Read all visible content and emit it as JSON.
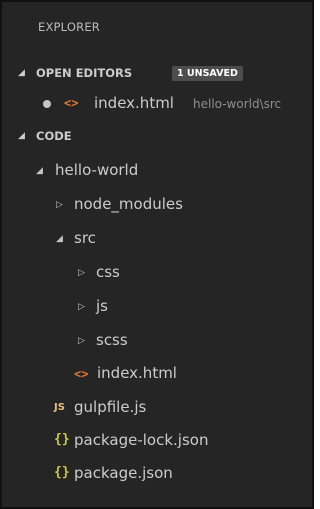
{
  "explorer": {
    "title": "EXPLORER"
  },
  "open_editors": {
    "label": "OPEN EDITORS",
    "badge": "1 UNSAVED",
    "caret_icon": "chevron-down-icon",
    "items": [
      {
        "name": "index.html",
        "path": "hello-world\\src",
        "icon": "html-file-icon",
        "modified": true
      }
    ]
  },
  "code": {
    "label": "CODE",
    "caret_icon": "chevron-down-icon"
  },
  "tree": {
    "hello_world": "hello-world",
    "node_modules": "node_modules",
    "src": "src",
    "css": "css",
    "js": "js",
    "scss": "scss",
    "index_html": "index.html",
    "gulpfile": "gulpfile.js",
    "package_lock": "package-lock.json",
    "package_json": "package.json"
  },
  "icons": {
    "html_glyph": "<>",
    "js_glyph": "JS",
    "json_glyph": "{}"
  },
  "colors": {
    "background": "#252526",
    "text": "#cccccc",
    "html_icon": "#e37933",
    "js_icon": "#e5c07b",
    "json_icon": "#cbcb41",
    "badge_bg": "#4d4d4d"
  }
}
